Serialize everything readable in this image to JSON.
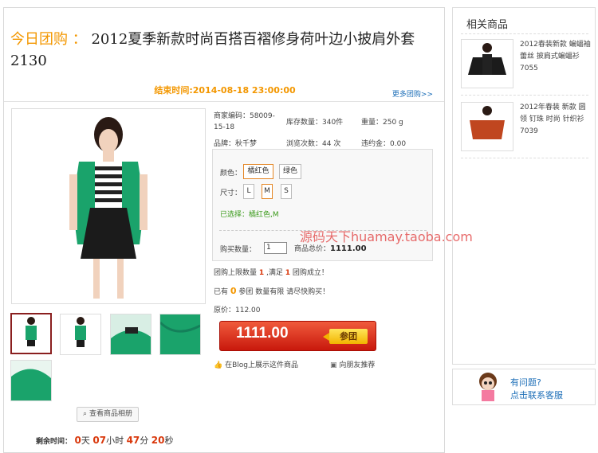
{
  "product": {
    "title_tag": "今日团购 ：",
    "title": "2012夏季新款时尚百搭百褶修身荷叶边小披肩外套2130",
    "end_time": "结束时间:2014-08-18 23:00:00",
    "more_link": "更多团购>>"
  },
  "info": {
    "code": "商家编码：58009-",
    "code2": "15-18",
    "stock": "库存数量：340件",
    "weight": "重量：250 g",
    "brand": "品牌：秋千梦",
    "views": "浏览次数：44 次",
    "penalty": "违约金：0.00"
  },
  "options": {
    "color_label": "颜色：",
    "colors": [
      "橘红色",
      "绿色"
    ],
    "size_label": "尺寸：",
    "sizes": [
      "L",
      "M",
      "S"
    ],
    "chosen": "已选择：橘红色,M",
    "qty_label": "购买数量：",
    "qty_value": "1",
    "total_label": "商品总价：",
    "total_value": "1111.00"
  },
  "group": {
    "limit_pre": "团购上限数量",
    "limit_num": "1",
    "limit_mid": ",满足",
    "limit_num2": "1",
    "limit_post": "团购成立！",
    "have_pre": "已有",
    "have_num": "0",
    "have_post": "参团 数量有限 请尽快购买！",
    "orig_price": "原价：112.00"
  },
  "buy": {
    "price": "1111.00",
    "join_label": "参团"
  },
  "share": {
    "blog": "在Blog上展示这件商品",
    "recommend": "向朋友推荐"
  },
  "album_btn": "查看商品相册",
  "countdown": {
    "label": "剩余时间：",
    "days": "0",
    "days_unit": "天",
    "hours": "07",
    "hours_unit": "小时",
    "minutes": "47",
    "minutes_unit": "分",
    "seconds": "20",
    "seconds_unit": "秒"
  },
  "watermark": "源码天下huamay.taoba.com",
  "sidebar": {
    "heading": "相关商品",
    "items": [
      {
        "text": "2012春装新款 蝙蝠袖 蕾丝 披肩式蝙蝠衫 7055"
      },
      {
        "text": "2012年春装 新款 圆领 钉珠 时尚 针织衫 7039"
      }
    ]
  },
  "help": {
    "question": "有问题?",
    "contact": "点击联系客服"
  },
  "colors": {
    "accent_orange": "#f39700",
    "price_red": "#d9380c",
    "link_blue": "#1e6fb8",
    "garment_green": "#1aa36b"
  }
}
